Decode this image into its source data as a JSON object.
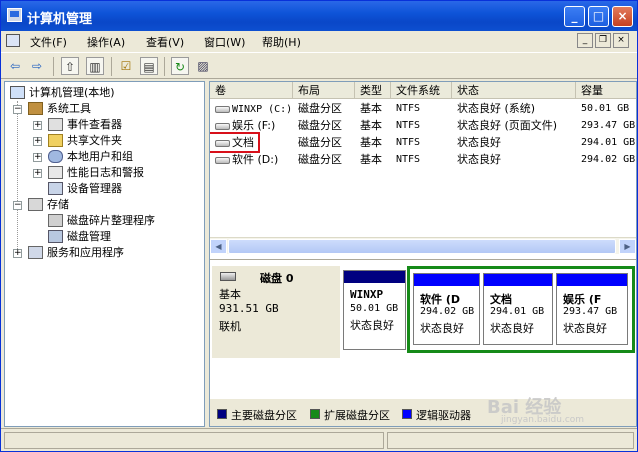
{
  "window": {
    "title": "计算机管理"
  },
  "menu": {
    "items": [
      "文件(F)",
      "操作(A)",
      "查看(V)",
      "窗口(W)",
      "帮助(H)"
    ]
  },
  "tree": {
    "root": "计算机管理(本地)",
    "system_tools": "系统工具",
    "event_viewer": "事件查看器",
    "shared_folders": "共享文件夹",
    "local_users": "本地用户和组",
    "perf_logs": "性能日志和警报",
    "device_manager": "设备管理器",
    "storage": "存储",
    "defrag": "磁盘碎片整理程序",
    "disk_mgmt": "磁盘管理",
    "services": "服务和应用程序"
  },
  "volume_table": {
    "columns": [
      "卷",
      "布局",
      "类型",
      "文件系统",
      "状态",
      "容量"
    ],
    "rows": [
      [
        "WINXP (C:)",
        "磁盘分区",
        "基本",
        "NTFS",
        "状态良好 (系统)",
        "50.01 GB"
      ],
      [
        "娱乐 (F:)",
        "磁盘分区",
        "基本",
        "NTFS",
        "状态良好 (页面文件)",
        "293.47 GB"
      ],
      [
        "文档",
        "磁盘分区",
        "基本",
        "NTFS",
        "状态良好",
        "294.01 GB"
      ],
      [
        "软件 (D:)",
        "磁盘分区",
        "基本",
        "NTFS",
        "状态良好",
        "294.02 GB"
      ]
    ]
  },
  "disk": {
    "name": "磁盘 0",
    "type": "基本",
    "size": "931.51 GB",
    "status": "联机",
    "partitions": [
      {
        "name": "WINXP",
        "size": "50.01 GB",
        "status": "状态良好",
        "color": "#000080"
      },
      {
        "name": "软件  (D",
        "size": "294.02 GB",
        "status": "状态良好",
        "color": "#0000ff"
      },
      {
        "name": "文档",
        "size": "294.01 GB",
        "status": "状态良好",
        "color": "#0000ff"
      },
      {
        "name": "娱乐  (F",
        "size": "293.47 GB",
        "status": "状态良好",
        "color": "#0000ff"
      }
    ]
  },
  "legend": {
    "primary": "主要磁盘分区",
    "primary_color": "#000080",
    "extended": "扩展磁盘分区",
    "extended_color": "#168a18",
    "logical": "逻辑驱动器",
    "logical_color": "#0000ff"
  },
  "watermark": {
    "text": "Bai 经验",
    "sub": "jingyan.baidu.com"
  }
}
